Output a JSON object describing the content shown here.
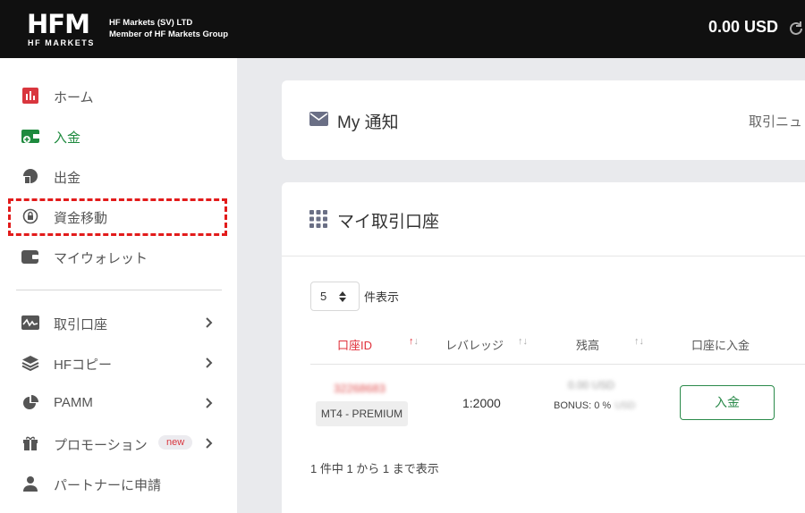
{
  "header": {
    "logo_text": "HFM",
    "logo_subtext": "HF MARKETS",
    "company_line1": "HF Markets (SV) LTD",
    "company_line2": "Member of HF Markets Group",
    "balance": "0.00 USD"
  },
  "sidebar": {
    "items": [
      {
        "label": "ホーム",
        "icon": "chart-bar-icon",
        "color": "#d9363e"
      },
      {
        "label": "入金",
        "icon": "wallet-plus-icon",
        "color": "#1e8a3e"
      },
      {
        "label": "出金",
        "icon": "wallet-out-icon",
        "color": "#555555"
      },
      {
        "label": "資金移動",
        "icon": "transfer-icon",
        "color": "#555555"
      },
      {
        "label": "マイウォレット",
        "icon": "wallet-icon",
        "color": "#555555"
      },
      {
        "label": "取引口座",
        "icon": "pulse-icon",
        "color": "#555555"
      },
      {
        "label": "HFコピー",
        "icon": "layers-icon",
        "color": "#555555"
      },
      {
        "label": "PAMM",
        "icon": "pie-icon",
        "color": "#555555"
      },
      {
        "label": "プロモーション",
        "icon": "gift-icon",
        "color": "#555555",
        "badge": "new"
      },
      {
        "label": "パートナーに申請",
        "icon": "user-icon",
        "color": "#555555"
      }
    ]
  },
  "notifications": {
    "title": "My 通知",
    "link": "取引ニュ"
  },
  "accounts": {
    "title": "マイ取引口座",
    "per_page_value": "5",
    "per_page_label": "件表示",
    "columns": [
      "口座ID",
      "レバレッジ",
      "残高",
      "口座に入金"
    ],
    "row": {
      "account_id": "32268683",
      "account_type": "MT4 - PREMIUM",
      "leverage": "1:2000",
      "balance": "0.00 USD",
      "bonus_label": "BONUS: 0 %",
      "bonus_currency": "USD",
      "deposit_button": "入金"
    },
    "footer": "1 件中 1 から 1 まで表示"
  }
}
